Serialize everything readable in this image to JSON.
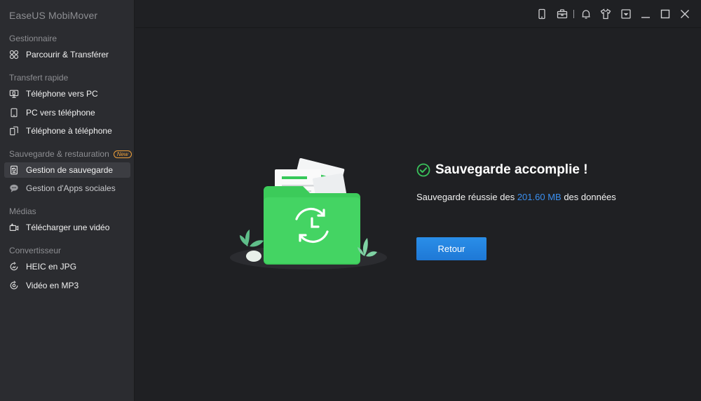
{
  "app": {
    "title": "EaseUS MobiMover"
  },
  "sidebar": {
    "sections": [
      {
        "title": "Gestionnaire",
        "items": [
          {
            "label": "Parcourir & Transférer",
            "icon": "grid-icon"
          }
        ]
      },
      {
        "title": "Transfert rapide",
        "items": [
          {
            "label": "Téléphone vers PC",
            "icon": "phone-to-pc-icon"
          },
          {
            "label": "PC vers téléphone",
            "icon": "pc-to-phone-icon"
          },
          {
            "label": "Téléphone à téléphone",
            "icon": "phone-to-phone-icon"
          }
        ]
      },
      {
        "title": "Sauvegarde & restauration",
        "badge": "New",
        "items": [
          {
            "label": "Gestion de sauvegarde",
            "icon": "backup-icon",
            "active": true
          },
          {
            "label": "Gestion d'Apps sociales",
            "icon": "chat-icon"
          }
        ]
      },
      {
        "title": "Médias",
        "items": [
          {
            "label": "Télécharger une vidéo",
            "icon": "video-download-icon"
          }
        ]
      },
      {
        "title": "Convertisseur",
        "items": [
          {
            "label": "HEIC en JPG",
            "icon": "convert-image-icon"
          },
          {
            "label": "Vidéo en MP3",
            "icon": "convert-audio-icon"
          }
        ]
      }
    ]
  },
  "topbar": {
    "icons": [
      "phone-icon",
      "toolbox-icon",
      "bell-icon",
      "tshirt-icon",
      "dropdown-menu-icon",
      "minimize-icon",
      "maximize-icon",
      "close-icon"
    ]
  },
  "result": {
    "title": "Sauvegarde accomplie !",
    "desc_prefix": "Sauvegarde réussie des",
    "size": "201.60 MB",
    "desc_suffix": "des données",
    "button_label": "Retour"
  },
  "colors": {
    "accent": "#2a8ee8",
    "success": "#3ac25b",
    "sidebar_bg": "#2b2c30",
    "main_bg": "#1f2023",
    "highlight": "#3b8ff0",
    "badge": "#f0a13a"
  }
}
